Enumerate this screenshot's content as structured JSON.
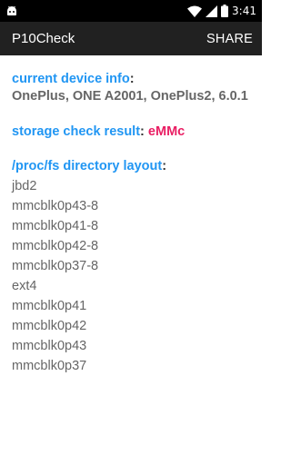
{
  "status_bar": {
    "time": "3:41",
    "icons": [
      "android-icon",
      "wifi-icon",
      "cell-signal-icon",
      "battery-icon"
    ]
  },
  "app_bar": {
    "title": "P10Check",
    "share_label": "SHARE"
  },
  "device_info": {
    "label": "current device info",
    "colon": ":",
    "value": "OnePlus, ONE A2001, OnePlus2, 6.0.1"
  },
  "storage_check": {
    "label": "storage check result",
    "colon": ":",
    "value": "eMMc"
  },
  "proc_fs": {
    "label": "/proc/fs directory layout",
    "colon": ":",
    "entries": [
      "jbd2",
      "mmcblk0p43-8",
      "mmcblk0p41-8",
      "mmcblk0p42-8",
      "mmcblk0p37-8",
      "ext4",
      "mmcblk0p41",
      "mmcblk0p42",
      "mmcblk0p43",
      "mmcblk0p37"
    ]
  },
  "colors": {
    "label_blue": "#2196f3",
    "value_pink": "#e91e63",
    "toolbar": "#212121",
    "status_bar": "#000000"
  }
}
